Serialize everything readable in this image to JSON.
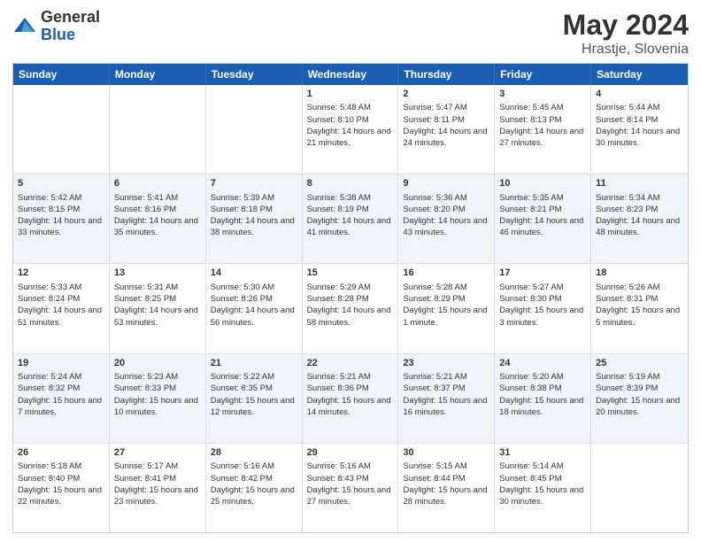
{
  "header": {
    "logo_general": "General",
    "logo_blue": "Blue",
    "title": "May 2024",
    "location": "Hrastje, Slovenia"
  },
  "days_of_week": [
    "Sunday",
    "Monday",
    "Tuesday",
    "Wednesday",
    "Thursday",
    "Friday",
    "Saturday"
  ],
  "weeks": [
    [
      {
        "day": "",
        "info": ""
      },
      {
        "day": "",
        "info": ""
      },
      {
        "day": "",
        "info": ""
      },
      {
        "day": "1",
        "info": "Sunrise: 5:48 AM\nSunset: 8:10 PM\nDaylight: 14 hours and 21 minutes."
      },
      {
        "day": "2",
        "info": "Sunrise: 5:47 AM\nSunset: 8:11 PM\nDaylight: 14 hours and 24 minutes."
      },
      {
        "day": "3",
        "info": "Sunrise: 5:45 AM\nSunset: 8:13 PM\nDaylight: 14 hours and 27 minutes."
      },
      {
        "day": "4",
        "info": "Sunrise: 5:44 AM\nSunset: 8:14 PM\nDaylight: 14 hours and 30 minutes."
      }
    ],
    [
      {
        "day": "5",
        "info": "Sunrise: 5:42 AM\nSunset: 8:15 PM\nDaylight: 14 hours and 33 minutes."
      },
      {
        "day": "6",
        "info": "Sunrise: 5:41 AM\nSunset: 8:16 PM\nDaylight: 14 hours and 35 minutes."
      },
      {
        "day": "7",
        "info": "Sunrise: 5:39 AM\nSunset: 8:18 PM\nDaylight: 14 hours and 38 minutes."
      },
      {
        "day": "8",
        "info": "Sunrise: 5:38 AM\nSunset: 8:19 PM\nDaylight: 14 hours and 41 minutes."
      },
      {
        "day": "9",
        "info": "Sunrise: 5:36 AM\nSunset: 8:20 PM\nDaylight: 14 hours and 43 minutes."
      },
      {
        "day": "10",
        "info": "Sunrise: 5:35 AM\nSunset: 8:21 PM\nDaylight: 14 hours and 46 minutes."
      },
      {
        "day": "11",
        "info": "Sunrise: 5:34 AM\nSunset: 8:23 PM\nDaylight: 14 hours and 48 minutes."
      }
    ],
    [
      {
        "day": "12",
        "info": "Sunrise: 5:33 AM\nSunset: 8:24 PM\nDaylight: 14 hours and 51 minutes."
      },
      {
        "day": "13",
        "info": "Sunrise: 5:31 AM\nSunset: 8:25 PM\nDaylight: 14 hours and 53 minutes."
      },
      {
        "day": "14",
        "info": "Sunrise: 5:30 AM\nSunset: 8:26 PM\nDaylight: 14 hours and 56 minutes."
      },
      {
        "day": "15",
        "info": "Sunrise: 5:29 AM\nSunset: 8:28 PM\nDaylight: 14 hours and 58 minutes."
      },
      {
        "day": "16",
        "info": "Sunrise: 5:28 AM\nSunset: 8:29 PM\nDaylight: 15 hours and 1 minute."
      },
      {
        "day": "17",
        "info": "Sunrise: 5:27 AM\nSunset: 8:30 PM\nDaylight: 15 hours and 3 minutes."
      },
      {
        "day": "18",
        "info": "Sunrise: 5:26 AM\nSunset: 8:31 PM\nDaylight: 15 hours and 5 minutes."
      }
    ],
    [
      {
        "day": "19",
        "info": "Sunrise: 5:24 AM\nSunset: 8:32 PM\nDaylight: 15 hours and 7 minutes."
      },
      {
        "day": "20",
        "info": "Sunrise: 5:23 AM\nSunset: 8:33 PM\nDaylight: 15 hours and 10 minutes."
      },
      {
        "day": "21",
        "info": "Sunrise: 5:22 AM\nSunset: 8:35 PM\nDaylight: 15 hours and 12 minutes."
      },
      {
        "day": "22",
        "info": "Sunrise: 5:21 AM\nSunset: 8:36 PM\nDaylight: 15 hours and 14 minutes."
      },
      {
        "day": "23",
        "info": "Sunrise: 5:21 AM\nSunset: 8:37 PM\nDaylight: 15 hours and 16 minutes."
      },
      {
        "day": "24",
        "info": "Sunrise: 5:20 AM\nSunset: 8:38 PM\nDaylight: 15 hours and 18 minutes."
      },
      {
        "day": "25",
        "info": "Sunrise: 5:19 AM\nSunset: 8:39 PM\nDaylight: 15 hours and 20 minutes."
      }
    ],
    [
      {
        "day": "26",
        "info": "Sunrise: 5:18 AM\nSunset: 8:40 PM\nDaylight: 15 hours and 22 minutes."
      },
      {
        "day": "27",
        "info": "Sunrise: 5:17 AM\nSunset: 8:41 PM\nDaylight: 15 hours and 23 minutes."
      },
      {
        "day": "28",
        "info": "Sunrise: 5:16 AM\nSunset: 8:42 PM\nDaylight: 15 hours and 25 minutes."
      },
      {
        "day": "29",
        "info": "Sunrise: 5:16 AM\nSunset: 8:43 PM\nDaylight: 15 hours and 27 minutes."
      },
      {
        "day": "30",
        "info": "Sunrise: 5:15 AM\nSunset: 8:44 PM\nDaylight: 15 hours and 28 minutes."
      },
      {
        "day": "31",
        "info": "Sunrise: 5:14 AM\nSunset: 8:45 PM\nDaylight: 15 hours and 30 minutes."
      },
      {
        "day": "",
        "info": ""
      }
    ]
  ]
}
